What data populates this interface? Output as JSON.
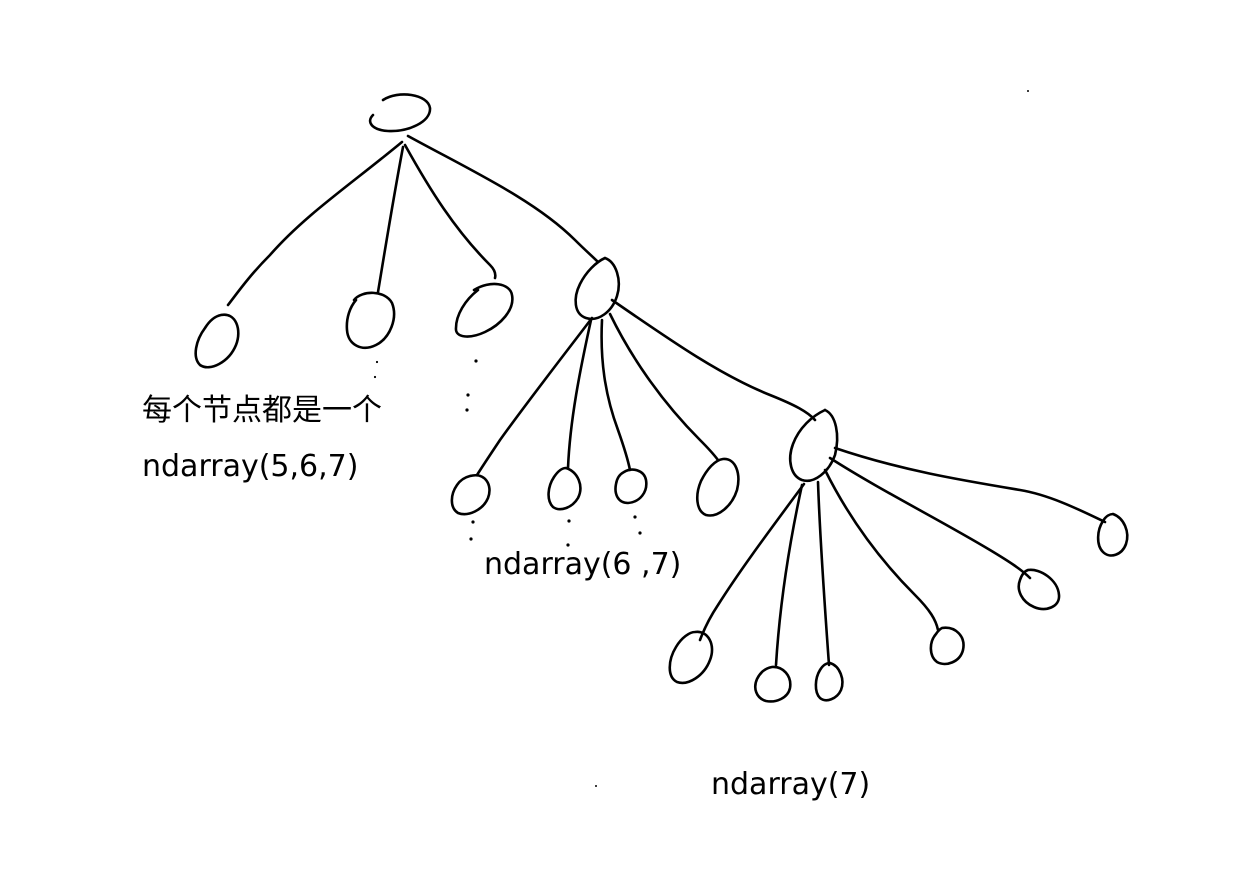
{
  "labels": {
    "root_line1": "每个节点都是一个",
    "root_line2": "ndarray(5,6,7)",
    "mid": "ndarray(6 ,7)",
    "leaf": "ndarray(7)"
  },
  "style": {
    "stroke_color": "#000000",
    "background": "#ffffff"
  }
}
